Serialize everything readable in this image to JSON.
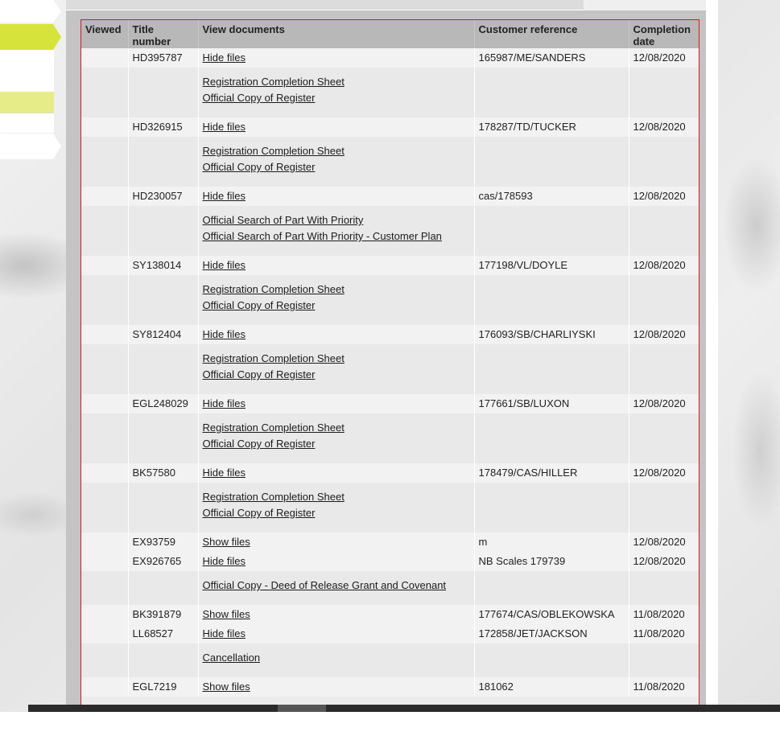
{
  "table": {
    "headers": {
      "viewed": "Viewed",
      "title_number": "Title number",
      "view_documents": "View documents",
      "customer_reference": "Customer reference",
      "completion_date": "Completion date"
    },
    "rows": [
      {
        "title": "HD395787",
        "toggle": "Hide files",
        "ref": "165987/ME/SANDERS",
        "date": "12/08/2020",
        "files": [
          "Registration Completion Sheet",
          "Official Copy of Register"
        ]
      },
      {
        "title": "HD326915",
        "toggle": "Hide files",
        "ref": "178287/TD/TUCKER",
        "date": "12/08/2020",
        "files": [
          "Registration Completion Sheet",
          "Official Copy of Register"
        ]
      },
      {
        "title": "HD230057",
        "toggle": "Hide files",
        "ref": "cas/178593",
        "date": "12/08/2020",
        "files": [
          "Official Search of Part With Priority",
          "Official Search of Part With Priority - Customer Plan"
        ]
      },
      {
        "title": "SY138014",
        "toggle": "Hide files",
        "ref": "177198/VL/DOYLE",
        "date": "12/08/2020",
        "files": [
          "Registration Completion Sheet",
          "Official Copy of Register"
        ]
      },
      {
        "title": "SY812404",
        "toggle": "Hide files",
        "ref": "176093/SB/CHARLIYSKI",
        "date": "12/08/2020",
        "files": [
          "Registration Completion Sheet",
          "Official Copy of Register"
        ]
      },
      {
        "title": "EGL248029",
        "toggle": "Hide files",
        "ref": "177661/SB/LUXON",
        "date": "12/08/2020",
        "files": [
          "Registration Completion Sheet",
          "Official Copy of Register"
        ]
      },
      {
        "title": "BK57580",
        "toggle": "Hide files",
        "ref": "178479/CAS/HILLER",
        "date": "12/08/2020",
        "files": [
          "Registration Completion Sheet",
          "Official Copy of Register"
        ]
      },
      {
        "title": "EX93759",
        "toggle": "Show files",
        "ref": "m",
        "date": "12/08/2020",
        "files": []
      },
      {
        "title": "EX926765",
        "toggle": "Hide files",
        "ref": "NB Scales 179739",
        "date": "12/08/2020",
        "files": [
          "Official Copy - Deed of Release Grant and Covenant"
        ]
      },
      {
        "title": "BK391879",
        "toggle": "Show files",
        "ref": "177674/CAS/OBLEKOWSKA",
        "date": "11/08/2020",
        "files": []
      },
      {
        "title": "LL68527",
        "toggle": "Hide files",
        "ref": "172858/JET/JACKSON",
        "date": "11/08/2020",
        "files": [
          "Cancellation"
        ]
      },
      {
        "title": "EGL7219",
        "toggle": "Show files",
        "ref": "181062",
        "date": "11/08/2020",
        "files": []
      }
    ]
  },
  "colors": {
    "accent": "#d6e33a",
    "accent_light": "#e6ec88",
    "highlight_border": "#e0141e",
    "header_bg": "#b8b8b8"
  }
}
